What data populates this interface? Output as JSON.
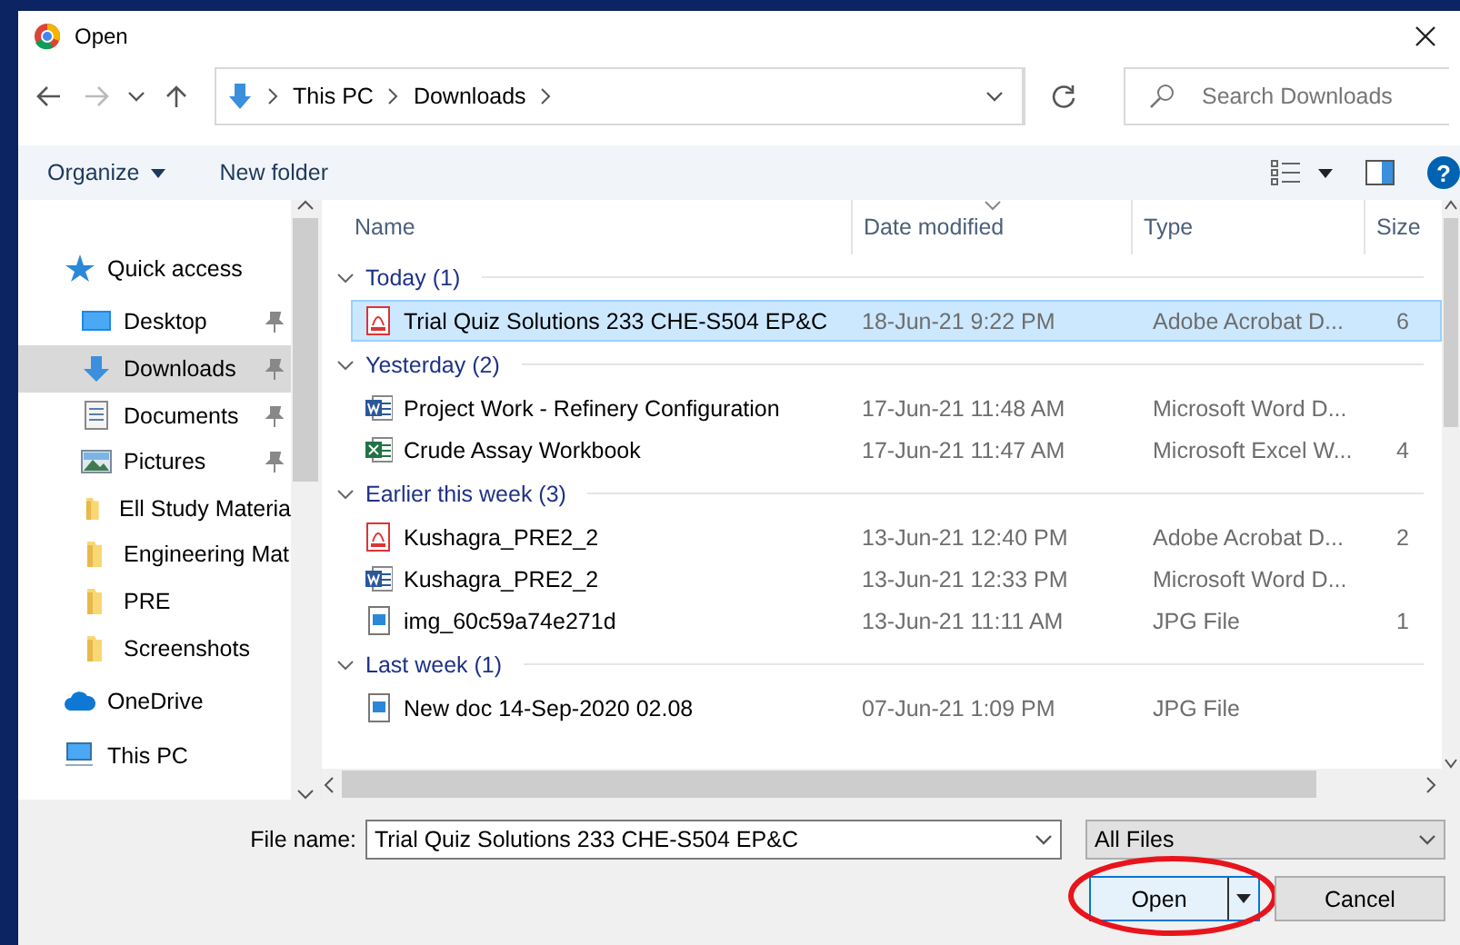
{
  "window": {
    "title": "Open"
  },
  "navigation": {
    "back_disabled": false,
    "forward_disabled": true
  },
  "address": {
    "path": [
      "This PC",
      "Downloads"
    ]
  },
  "search": {
    "placeholder": "Search Downloads"
  },
  "toolbar": {
    "organize": "Organize",
    "new_folder": "New folder",
    "help": "?"
  },
  "sidebar": {
    "items": [
      {
        "label": "Quick access",
        "kind": "star",
        "pinned": false,
        "selected": false,
        "children": [
          {
            "label": "Desktop",
            "kind": "desktop",
            "pinned": true,
            "selected": false
          },
          {
            "label": "Downloads",
            "kind": "download",
            "pinned": true,
            "selected": true
          },
          {
            "label": "Documents",
            "kind": "documents",
            "pinned": true,
            "selected": false
          },
          {
            "label": "Pictures",
            "kind": "pictures",
            "pinned": true,
            "selected": false
          },
          {
            "label": "Ell Study Materia",
            "kind": "folder",
            "pinned": false,
            "selected": false
          },
          {
            "label": "Engineering Mat",
            "kind": "folder",
            "pinned": false,
            "selected": false
          },
          {
            "label": "PRE",
            "kind": "folder",
            "pinned": false,
            "selected": false
          },
          {
            "label": "Screenshots",
            "kind": "folder",
            "pinned": false,
            "selected": false
          }
        ]
      },
      {
        "label": "OneDrive",
        "kind": "cloud",
        "pinned": false,
        "selected": false
      },
      {
        "label": "This PC",
        "kind": "pc",
        "pinned": false,
        "selected": false
      }
    ]
  },
  "table": {
    "columns": [
      {
        "label": "Name",
        "sorted": false
      },
      {
        "label": "Date modified",
        "sorted": true
      },
      {
        "label": "Type",
        "sorted": false
      },
      {
        "label": "Size",
        "sorted": false
      }
    ],
    "groups": [
      {
        "label": "Today (1)",
        "expanded": true,
        "files": [
          {
            "name": "Trial Quiz Solutions 233 CHE-S504 EP&C",
            "date": "18-Jun-21 9:22 PM",
            "type": "Adobe Acrobat D...",
            "size": "6",
            "kind": "pdf",
            "selected": true
          }
        ]
      },
      {
        "label": "Yesterday (2)",
        "expanded": true,
        "files": [
          {
            "name": "Project Work - Refinery Configuration",
            "date": "17-Jun-21 11:48 AM",
            "type": "Microsoft Word D...",
            "kind": "word",
            "selected": false
          },
          {
            "name": "Crude Assay Workbook",
            "date": "17-Jun-21 11:47 AM",
            "type": "Microsoft Excel W...",
            "size": "4",
            "kind": "excel",
            "selected": false
          }
        ]
      },
      {
        "label": "Earlier this week (3)",
        "expanded": true,
        "files": [
          {
            "name": "Kushagra_PRE2_2",
            "date": "13-Jun-21 12:40 PM",
            "type": "Adobe Acrobat D...",
            "size": "2",
            "kind": "pdf",
            "selected": false
          },
          {
            "name": "Kushagra_PRE2_2",
            "date": "13-Jun-21 12:33 PM",
            "type": "Microsoft Word D...",
            "kind": "word",
            "selected": false
          },
          {
            "name": "img_60c59a74e271d",
            "date": "13-Jun-21 11:11 AM",
            "type": "JPG File",
            "size": "1",
            "kind": "image",
            "selected": false
          }
        ]
      },
      {
        "label": "Last week (1)",
        "expanded": true,
        "files": [
          {
            "name": "New doc 14-Sep-2020 02.08",
            "date": "07-Jun-21 1:09 PM",
            "type": "JPG File",
            "kind": "image",
            "selected": false
          }
        ]
      }
    ]
  },
  "footer": {
    "file_name_label": "File name:",
    "file_name": "Trial Quiz Solutions 233 CHE-S504 EP&C",
    "file_type": "All Files",
    "buttons": [
      {
        "label": "Open",
        "kind": "split",
        "circled": true
      },
      {
        "label": "Cancel",
        "kind": "plain",
        "circled": false
      }
    ]
  }
}
